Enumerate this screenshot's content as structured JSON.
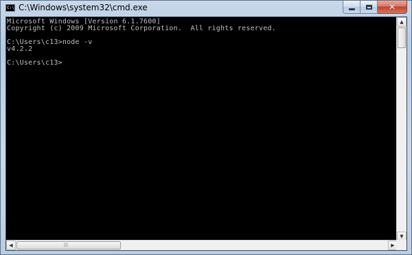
{
  "window": {
    "title": "C:\\Windows\\system32\\cmd.exe",
    "icon": "cmd-icon",
    "icon_text": "C:\\"
  },
  "console": {
    "lines": [
      "Microsoft Windows [Version 6.1.7600]",
      "Copyright (c) 2009 Microsoft Corporation.  All rights reserved.",
      "",
      "C:\\Users\\c13>node -v",
      "v4.2.2",
      "",
      "C:\\Users\\c13>"
    ],
    "foreground": "#c0c0c0",
    "background": "#000000"
  },
  "caption_buttons": {
    "minimize": "minimize-icon",
    "maximize": "maximize-icon",
    "close": "close-icon",
    "close_glyph": "✕"
  },
  "scrollbars": {
    "up_glyph": "▲",
    "down_glyph": "▼",
    "left_glyph": "◀",
    "right_glyph": "▶",
    "grip_glyph": "|||"
  }
}
